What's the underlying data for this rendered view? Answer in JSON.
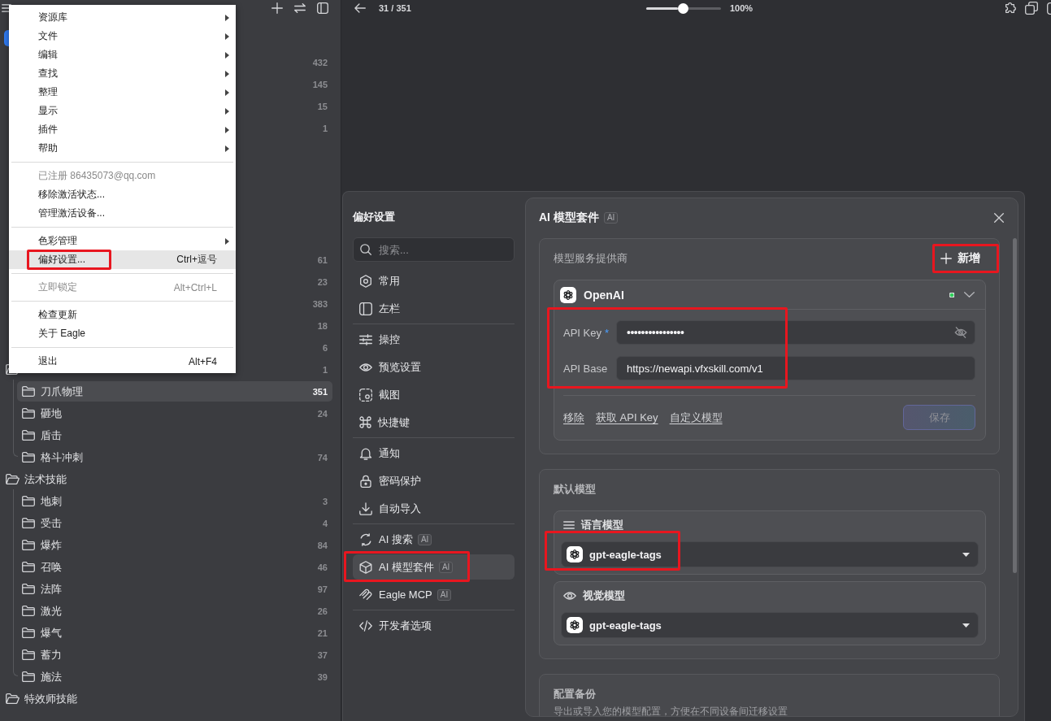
{
  "sidebar": {
    "counts_top": [
      {
        "count": "432"
      },
      {
        "count": "145"
      },
      {
        "count": "15"
      },
      {
        "count": "1"
      }
    ],
    "counts_mid": [
      {
        "count": "61"
      },
      {
        "count": "23"
      },
      {
        "count": "383"
      },
      {
        "count": "18"
      },
      {
        "count": "6"
      }
    ],
    "folders": [
      {
        "count": "1",
        "expanded": true,
        "selected": false,
        "children": [
          {
            "label": "刀爪物理",
            "count": "351",
            "expanded": false,
            "selected": true
          },
          {
            "label": "砸地",
            "count": "24",
            "expanded": false,
            "selected": false
          },
          {
            "label": "盾击",
            "expanded": false,
            "selected": false
          },
          {
            "label": "格斗冲刺",
            "count": "74",
            "expanded": false,
            "selected": false
          }
        ]
      },
      {
        "label": "法术技能",
        "expanded": true,
        "selected": false,
        "children": [
          {
            "label": "地刺",
            "count": "3",
            "expanded": false,
            "selected": false
          },
          {
            "label": "受击",
            "count": "4",
            "expanded": false,
            "selected": false
          },
          {
            "label": "爆炸",
            "count": "84",
            "expanded": false,
            "selected": false
          },
          {
            "label": "召唤",
            "count": "46",
            "expanded": false,
            "selected": false
          },
          {
            "label": "法阵",
            "count": "97",
            "expanded": false,
            "selected": false
          },
          {
            "label": "激光",
            "count": "26",
            "expanded": false,
            "selected": false
          },
          {
            "label": "爆气",
            "count": "21",
            "expanded": false,
            "selected": false
          },
          {
            "label": "蓄力",
            "count": "37",
            "expanded": false,
            "selected": false
          },
          {
            "label": "施法",
            "count": "39",
            "expanded": false,
            "selected": false
          }
        ]
      },
      {
        "label": "特效师技能",
        "expanded": true,
        "selected": false
      }
    ]
  },
  "context_menu": {
    "items": [
      {
        "kind": "item",
        "label": "资源库",
        "submenu": true,
        "disabled": false,
        "selected": false,
        "highlighted": false
      },
      {
        "kind": "item",
        "label": "文件",
        "submenu": true,
        "disabled": false,
        "selected": false,
        "highlighted": false
      },
      {
        "kind": "item",
        "label": "编辑",
        "submenu": true,
        "disabled": false,
        "selected": false,
        "highlighted": false
      },
      {
        "kind": "item",
        "label": "查找",
        "submenu": true,
        "disabled": false,
        "selected": false,
        "highlighted": false
      },
      {
        "kind": "item",
        "label": "整理",
        "submenu": true,
        "disabled": false,
        "selected": false,
        "highlighted": false
      },
      {
        "kind": "item",
        "label": "显示",
        "submenu": true,
        "disabled": false,
        "selected": false,
        "highlighted": false
      },
      {
        "kind": "item",
        "label": "插件",
        "submenu": true,
        "disabled": false,
        "selected": false,
        "highlighted": false
      },
      {
        "kind": "item",
        "label": "帮助",
        "submenu": true,
        "disabled": false,
        "selected": false,
        "highlighted": false
      },
      {
        "kind": "separator"
      },
      {
        "kind": "item",
        "label": "已注册 86435073@qq.com",
        "submenu": false,
        "disabled": true,
        "selected": false,
        "highlighted": false
      },
      {
        "kind": "item",
        "label": "移除激活状态...",
        "submenu": false,
        "disabled": false,
        "selected": false,
        "highlighted": false
      },
      {
        "kind": "item",
        "label": "管理激活设备...",
        "submenu": false,
        "disabled": false,
        "selected": false,
        "highlighted": false
      },
      {
        "kind": "separator"
      },
      {
        "kind": "item",
        "label": "色彩管理",
        "submenu": true,
        "disabled": false,
        "selected": false,
        "highlighted": false
      },
      {
        "kind": "item",
        "label": "偏好设置...",
        "shortcut": "Ctrl+逗号",
        "submenu": false,
        "disabled": false,
        "selected": true,
        "highlighted": true
      },
      {
        "kind": "separator"
      },
      {
        "kind": "item",
        "label": "立即锁定",
        "shortcut": "Alt+Ctrl+L",
        "submenu": false,
        "disabled": true,
        "selected": false,
        "highlighted": false
      },
      {
        "kind": "separator"
      },
      {
        "kind": "item",
        "label": "检查更新",
        "submenu": false,
        "disabled": false,
        "selected": false,
        "highlighted": false
      },
      {
        "kind": "item",
        "label": "关于 Eagle",
        "submenu": false,
        "disabled": false,
        "selected": false,
        "highlighted": false
      },
      {
        "kind": "separator"
      },
      {
        "kind": "item",
        "label": "退出",
        "shortcut": "Alt+F4",
        "submenu": false,
        "disabled": false,
        "selected": false,
        "highlighted": false
      }
    ]
  },
  "viewer": {
    "counter": "31 / 351",
    "zoom": {
      "level": 0.5,
      "reading": "100%"
    }
  },
  "preferences": {
    "title": "偏好设置",
    "search": {
      "placeholder": "搜索..."
    },
    "nav_groups": [
      [
        {
          "label": "常用",
          "selected": false,
          "highlighted": false
        },
        {
          "label": "左栏",
          "selected": false,
          "highlighted": false
        }
      ],
      [
        {
          "label": "操控",
          "selected": false,
          "highlighted": false
        },
        {
          "label": "预览设置",
          "selected": false,
          "highlighted": false
        },
        {
          "label": "截图",
          "selected": false,
          "highlighted": false
        },
        {
          "label": "快捷键",
          "selected": false,
          "highlighted": false
        }
      ],
      [
        {
          "label": "通知",
          "selected": false,
          "highlighted": false
        },
        {
          "label": "密码保护",
          "selected": false,
          "highlighted": false
        },
        {
          "label": "自动导入",
          "selected": false,
          "highlighted": false
        }
      ],
      [
        {
          "label": "AI 搜索",
          "badge": "AI",
          "selected": false,
          "highlighted": false
        },
        {
          "label": "AI 模型套件",
          "badge": "AI",
          "selected": true,
          "highlighted": true
        },
        {
          "label": "Eagle MCP",
          "badge": "AI",
          "selected": false,
          "highlighted": false
        }
      ],
      [
        {
          "label": "开发者选项",
          "selected": false,
          "highlighted": false
        }
      ]
    ],
    "panel": {
      "title": "AI 模型套件",
      "badge": "AI",
      "providers": {
        "title": "模型服务提供商",
        "add_button": {
          "label": "新增",
          "highlighted": true
        },
        "provider": {
          "name": "OpenAI",
          "enabled": true,
          "expanded": true,
          "fields_highlighted": true,
          "fields": [
            {
              "kind": "secret",
              "label": "API Key",
              "mark": "*",
              "value": "••••••••••••••••"
            },
            {
              "kind": "text",
              "label": "API Base",
              "value": "https://newapi.vfxskill.com/v1"
            }
          ],
          "links": [
            {
              "label": "移除"
            },
            {
              "label": "获取 API Key"
            },
            {
              "label": "自定义模型"
            }
          ],
          "save_button": {
            "label": "保存",
            "disabled": true
          }
        }
      },
      "default_models": {
        "title": "默认模型",
        "models": [
          {
            "kind": "language",
            "label": "语言模型",
            "value": "gpt-eagle-tags",
            "highlighted": true
          },
          {
            "kind": "vision",
            "label": "视觉模型",
            "value": "gpt-eagle-tags",
            "highlighted": false
          }
        ]
      },
      "backup": {
        "title": "配置备份",
        "description": "导出或导入您的模型配置，方便在不同设备间迁移设置"
      }
    }
  }
}
